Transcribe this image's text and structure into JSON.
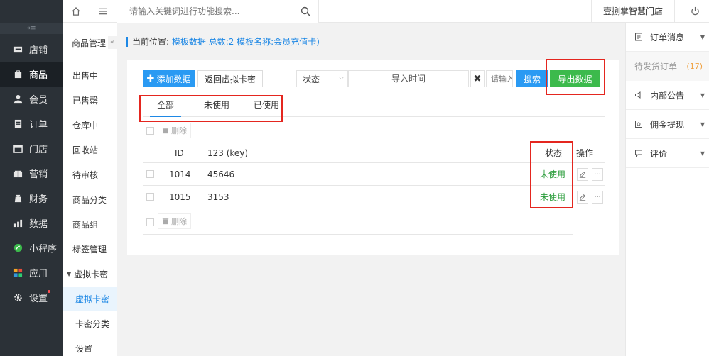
{
  "sidebar": {
    "toggle_label": "«≡",
    "items": [
      {
        "label": "店铺",
        "icon": "store-icon"
      },
      {
        "label": "商品",
        "icon": "goods-icon",
        "active": true
      },
      {
        "label": "会员",
        "icon": "member-icon"
      },
      {
        "label": "订单",
        "icon": "order-icon"
      },
      {
        "label": "门店",
        "icon": "shop-icon"
      },
      {
        "label": "营销",
        "icon": "marketing-icon"
      },
      {
        "label": "财务",
        "icon": "finance-icon"
      },
      {
        "label": "数据",
        "icon": "data-icon"
      },
      {
        "label": "小程序",
        "icon": "miniprogram-icon"
      },
      {
        "label": "应用",
        "icon": "apps-icon"
      },
      {
        "label": "设置",
        "icon": "settings-icon"
      }
    ]
  },
  "submenu": {
    "title": "商品管理",
    "collapse_glyph": "«",
    "items": [
      "出售中",
      "已售罄",
      "仓库中",
      "回收站",
      "待审核",
      "商品分类",
      "商品组",
      "标签管理"
    ],
    "group": "虚拟卡密",
    "children": [
      "虚拟卡密",
      "卡密分类",
      "设置"
    ]
  },
  "topbar": {
    "search_placeholder": "请输入关键词进行功能搜索...",
    "store_name": "壹捌掌智慧门店"
  },
  "breadcrumb": {
    "prefix": "当前位置:",
    "path": "模板数据 总数:2 模板名称:会员充值卡)"
  },
  "toolbar": {
    "add_label": "添加数据",
    "back_label": "返回虚拟卡密",
    "status_label": "状态",
    "time_placeholder": "导入时间",
    "clear_glyph": "✖",
    "keyword_placeholder": "请输入",
    "search_label": "搜索",
    "export_label": "导出数据"
  },
  "tabs": [
    "全部",
    "未使用",
    "已使用"
  ],
  "delete_label": "删除",
  "table": {
    "headers": {
      "id": "ID",
      "key": "123 (key)",
      "status": "状态",
      "action": "操作"
    },
    "rows": [
      {
        "id": "1014",
        "key": "45646",
        "status": "未使用"
      },
      {
        "id": "1015",
        "key": "3153",
        "status": "未使用"
      }
    ],
    "more_glyph": "···"
  },
  "rpanel": {
    "items": [
      {
        "label": "订单消息",
        "icon": "message-icon"
      },
      {
        "sub": "待发货订单",
        "count": "(17)"
      },
      {
        "label": "内部公告",
        "icon": "announcement-icon"
      },
      {
        "label": "佣金提现",
        "icon": "withdraw-icon"
      },
      {
        "label": "评价",
        "icon": "comment-icon"
      }
    ]
  },
  "colors": {
    "primary": "#2a9af3",
    "export_green": "#3cba4c",
    "status_green": "#2e9e3e",
    "annotation_red": "#e4261f",
    "sidebar_bg": "#2b3137"
  }
}
